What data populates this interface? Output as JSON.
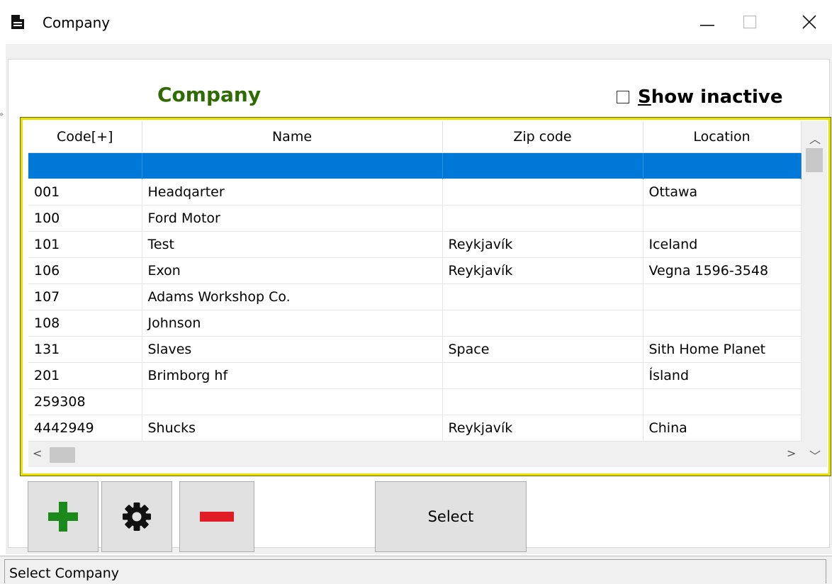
{
  "window": {
    "title": "Company",
    "title_icon": "document-icon",
    "controls": [
      "minimize-icon",
      "maximize-icon",
      "close-icon"
    ]
  },
  "heading": "Company",
  "heading_color": "#2e6b00",
  "show_inactive": {
    "label": "Show inactive",
    "mnemonic": "S",
    "checked": false
  },
  "grid": {
    "columns": [
      "Code[+]",
      "Name",
      "Zip code",
      "Location"
    ],
    "selected_row_color": "#0078d7",
    "highlight_border_color": "#e8e000",
    "rows": [
      [
        "",
        "",
        "",
        ""
      ],
      [
        "001",
        "Headqarter",
        "",
        "Ottawa"
      ],
      [
        "100",
        "Ford Motor",
        "",
        ""
      ],
      [
        "101",
        "Test",
        "Reykjavík",
        "Iceland"
      ],
      [
        "106",
        "Exon",
        "Reykjavík",
        "Vegna 1596-3548"
      ],
      [
        "107",
        "Adams Workshop Co.",
        "",
        ""
      ],
      [
        "108",
        "Johnson",
        "",
        ""
      ],
      [
        "131",
        "Slaves",
        "Space",
        "Sith Home Planet"
      ],
      [
        "201",
        "Brimborg hf",
        "",
        "Ísland"
      ],
      [
        "259308",
        "",
        "",
        ""
      ],
      [
        "4442949",
        "Shucks",
        "Reykjavík",
        "China"
      ]
    ]
  },
  "buttons": {
    "add_icon": "plus-icon",
    "add_color": "#1a8a1a",
    "settings_icon": "gear-icon",
    "remove_icon": "minus-icon",
    "remove_color": "#e01c24",
    "select_label": "Select"
  },
  "status": {
    "text": "Select Company"
  }
}
